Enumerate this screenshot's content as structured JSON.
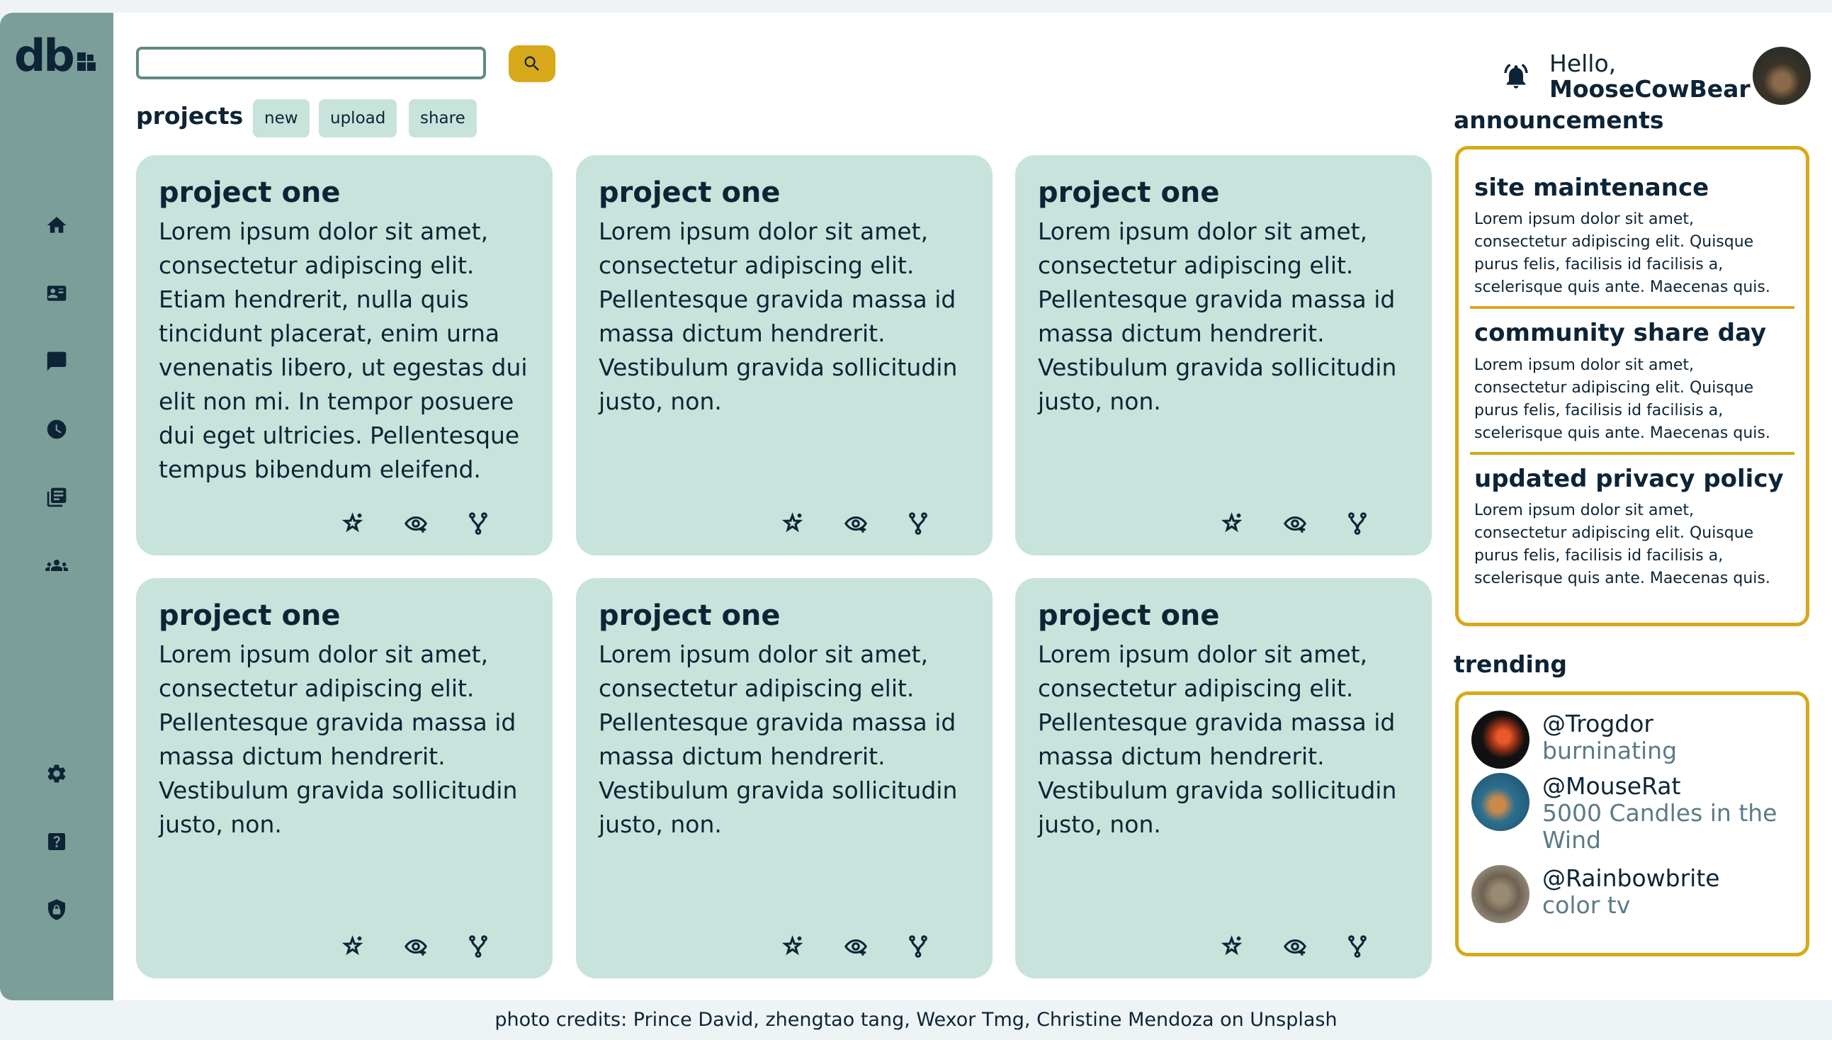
{
  "app": {
    "logo": "db"
  },
  "sidebar": {
    "items": [
      {
        "icon": "home-icon"
      },
      {
        "icon": "id-card-icon"
      },
      {
        "icon": "chat-icon"
      },
      {
        "icon": "clock-icon"
      },
      {
        "icon": "documents-icon"
      },
      {
        "icon": "people-icon"
      },
      {
        "icon": "gear-icon"
      },
      {
        "icon": "help-icon"
      },
      {
        "icon": "shield-icon"
      }
    ]
  },
  "search": {
    "value": "",
    "placeholder": ""
  },
  "projects": {
    "title": "projects",
    "buttons": {
      "new": "new",
      "upload": "upload",
      "share": "share"
    },
    "cards": [
      {
        "title": "project one",
        "body": "Lorem ipsum dolor sit amet, consectetur adipiscing elit. Etiam hendrerit, nulla quis tincidunt placerat, enim urna venenatis libero, ut egestas dui elit non mi. In tempor posuere dui eget ultricies. Pellentesque tempus bibendum eleifend."
      },
      {
        "title": "project one",
        "body": "Lorem ipsum dolor sit amet, consectetur adipiscing elit. Pellentesque gravida massa id massa dictum hendrerit. Vestibulum gravida sollicitudin justo, non."
      },
      {
        "title": "project one",
        "body": "Lorem ipsum dolor sit amet, consectetur adipiscing elit. Pellentesque gravida massa id massa dictum hendrerit. Vestibulum gravida sollicitudin justo, non."
      },
      {
        "title": "project one",
        "body": "Lorem ipsum dolor sit amet, consectetur adipiscing elit. Pellentesque gravida massa id massa dictum hendrerit. Vestibulum gravida sollicitudin justo, non."
      },
      {
        "title": "project one",
        "body": "Lorem ipsum dolor sit amet, consectetur adipiscing elit. Pellentesque gravida massa id massa dictum hendrerit. Vestibulum gravida sollicitudin justo, non."
      },
      {
        "title": "project one",
        "body": "Lorem ipsum dolor sit amet, consectetur adipiscing elit. Pellentesque gravida massa id massa dictum hendrerit. Vestibulum gravida sollicitudin justo, non."
      }
    ]
  },
  "header": {
    "greeting": "Hello,",
    "username": "MooseCowBear"
  },
  "announcements": {
    "title": "announcements",
    "items": [
      {
        "title": "site maintenance",
        "body": "Lorem ipsum dolor sit amet, consectetur adipiscing elit. Quisque purus felis, facilisis id facilisis a, scelerisque quis ante. Maecenas quis."
      },
      {
        "title": "community share day",
        "body": "Lorem ipsum dolor sit amet, consectetur adipiscing elit. Quisque purus felis, facilisis id facilisis a, scelerisque quis ante. Maecenas quis."
      },
      {
        "title": "updated privacy policy",
        "body": "Lorem ipsum dolor sit amet, consectetur adipiscing elit. Quisque purus felis, facilisis id facilisis a, scelerisque quis ante. Maecenas quis."
      }
    ]
  },
  "trending": {
    "title": "trending",
    "items": [
      {
        "handle": "@Trogdor",
        "project": "burninating"
      },
      {
        "handle": "@MouseRat",
        "project": "5000 Candles in the Wind"
      },
      {
        "handle": "@Rainbowbrite",
        "project": "color tv"
      }
    ]
  },
  "footer": {
    "credits": "photo credits: Prince David, zhengtao tang, Wexor Tmg, Christine Mendoza on Unsplash"
  },
  "colors": {
    "sidebar": "#7b9f98",
    "card": "#c8e3db",
    "accent": "#d8a81b",
    "text": "#0d2436"
  }
}
